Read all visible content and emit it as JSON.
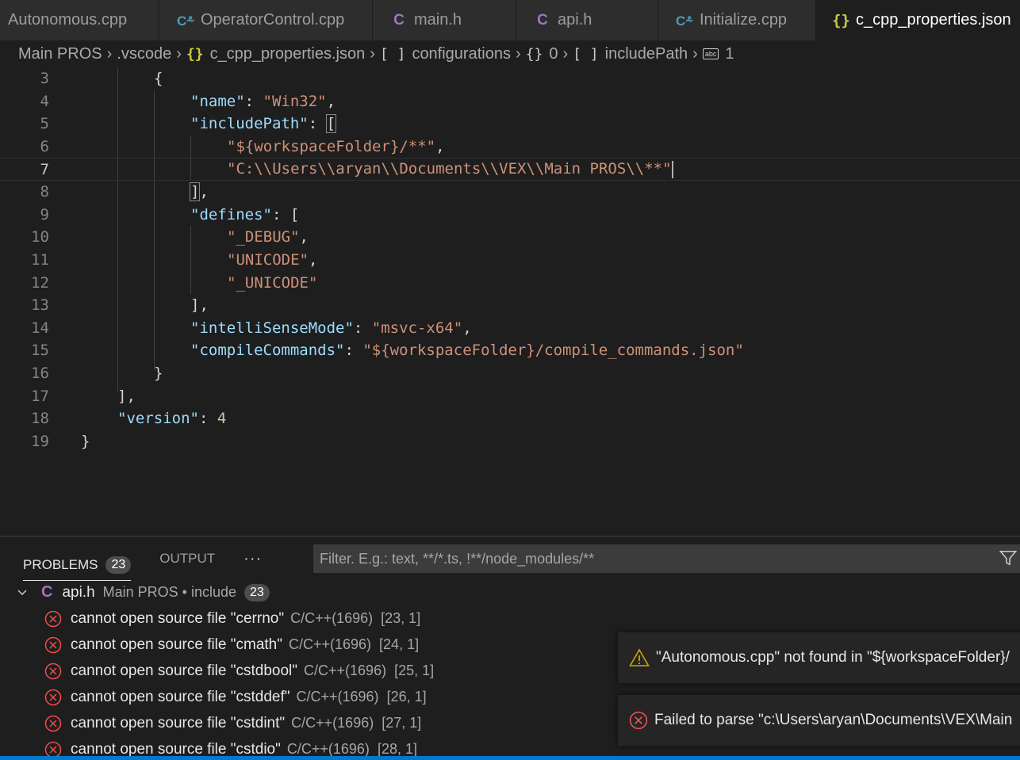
{
  "tabs": [
    {
      "label": "Autonomous.cpp",
      "icon": "none",
      "active": false
    },
    {
      "label": "OperatorControl.cpp",
      "icon": "cpp-file-icon",
      "active": false
    },
    {
      "label": "main.h",
      "icon": "c-header-icon",
      "active": false
    },
    {
      "label": "api.h",
      "icon": "c-header-icon",
      "active": false
    },
    {
      "label": "Initialize.cpp",
      "icon": "cpp-file-icon",
      "active": false
    },
    {
      "label": "c_cpp_properties.json",
      "icon": "json-file-icon",
      "active": true
    }
  ],
  "breadcrumb": {
    "folder": "Main PROS",
    "subfolder": ".vscode",
    "file_icon": "{}",
    "file": "c_cpp_properties.json",
    "array_icon": "[ ]",
    "configurations": "configurations",
    "object_icon": "{}",
    "index": "0",
    "array_icon2": "[ ]",
    "includePath": "includePath",
    "item": "1"
  },
  "editor": {
    "lines": [
      {
        "num": "3",
        "t1": "{"
      },
      {
        "num": "4",
        "k": "\"name\"",
        "sep": ": ",
        "s": "\"Win32\"",
        "tail": ","
      },
      {
        "num": "5",
        "k": "\"includePath\"",
        "sep": ": ",
        "bracket": "["
      },
      {
        "num": "6",
        "s": "\"${workspaceFolder}/**\"",
        "tail": ","
      },
      {
        "num": "7",
        "s": "\"C:\\\\Users\\\\aryan\\\\Documents\\\\VEX\\\\Main PROS\\\\**\""
      },
      {
        "num": "8",
        "bracket": "]",
        "tail": ","
      },
      {
        "num": "9",
        "k": "\"defines\"",
        "sep": ": ",
        "t1": "["
      },
      {
        "num": "10",
        "s": "\"_DEBUG\"",
        "tail": ","
      },
      {
        "num": "11",
        "s": "\"UNICODE\"",
        "tail": ","
      },
      {
        "num": "12",
        "s": "\"_UNICODE\""
      },
      {
        "num": "13",
        "t1": "],"
      },
      {
        "num": "14",
        "k": "\"intelliSenseMode\"",
        "sep": ": ",
        "s": "\"msvc-x64\"",
        "tail": ","
      },
      {
        "num": "15",
        "k": "\"compileCommands\"",
        "sep": ": ",
        "s": "\"${workspaceFolder}/compile_commands.json\""
      },
      {
        "num": "16",
        "t1": "}"
      },
      {
        "num": "17",
        "t1": "],"
      },
      {
        "num": "18",
        "k": "\"version\"",
        "sep": ": ",
        "n": "4"
      },
      {
        "num": "19",
        "t1": "}"
      }
    ]
  },
  "panel": {
    "problems_label": "PROBLEMS",
    "problems_count": "23",
    "output_label": "OUTPUT",
    "more": "···",
    "filter_placeholder": "Filter. E.g.: text, **/*.ts, !**/node_modules/**",
    "file": {
      "icon": "C",
      "name": "api.h",
      "desc": "Main PROS • include",
      "count": "23"
    },
    "errors": [
      {
        "msg": "cannot open source file \"cerrno\"",
        "src": "C/C++(1696)",
        "loc": "[23, 1]"
      },
      {
        "msg": "cannot open source file \"cmath\"",
        "src": "C/C++(1696)",
        "loc": "[24, 1]"
      },
      {
        "msg": "cannot open source file \"cstdbool\"",
        "src": "C/C++(1696)",
        "loc": "[25, 1]"
      },
      {
        "msg": "cannot open source file \"cstddef\"",
        "src": "C/C++(1696)",
        "loc": "[26, 1]"
      },
      {
        "msg": "cannot open source file \"cstdint\"",
        "src": "C/C++(1696)",
        "loc": "[27, 1]"
      },
      {
        "msg": "cannot open source file \"cstdio\"",
        "src": "C/C++(1696)",
        "loc": "[28, 1]"
      }
    ]
  },
  "notifications": [
    {
      "type": "warning",
      "text": "\"Autonomous.cpp\" not found in \"${workspaceFolder}/"
    },
    {
      "type": "error",
      "text": "Failed to parse \"c:\\Users\\aryan\\Documents\\VEX\\Main"
    }
  ],
  "colors": {
    "accent": "#007acc",
    "error": "#f14c4c",
    "warning": "#cca700",
    "json_icon": "#cbcb41",
    "c_icon": "#a074c4",
    "cpp_icon": "#519aba"
  }
}
